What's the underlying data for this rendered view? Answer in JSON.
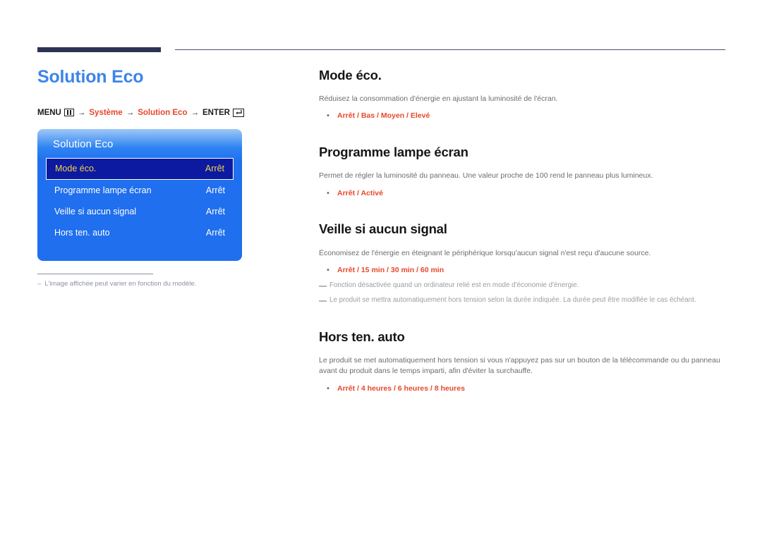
{
  "page": {
    "title": "Solution Eco"
  },
  "breadcrumb": {
    "menu_label": "MENU",
    "menu_icon": "menu-grid-icon",
    "arrow": "→",
    "step1": "Système",
    "step2": "Solution Eco",
    "enter_label": "ENTER",
    "enter_icon": "enter-return-icon"
  },
  "osd": {
    "title": "Solution Eco",
    "rows": [
      {
        "label": "Mode éco.",
        "value": "Arrêt",
        "selected": true
      },
      {
        "label": "Programme lampe écran",
        "value": "Arrêt",
        "selected": false
      },
      {
        "label": "Veille si aucun signal",
        "value": "Arrêt",
        "selected": false
      },
      {
        "label": "Hors ten. auto",
        "value": "Arrêt",
        "selected": false
      }
    ]
  },
  "left_note": {
    "dash": "–",
    "text": "L'image affichée peut varier en fonction du modèle."
  },
  "sections": [
    {
      "heading": "Mode éco.",
      "paragraph": "Réduisez la consommation d'énergie en ajustant la luminosité de l'écran.",
      "bullet_dot": "•",
      "options": [
        "Arrêt",
        "Bas",
        "Moyen",
        "Elevé"
      ],
      "options_text": "Arrêt / Bas / Moyen / Elevé",
      "notes": []
    },
    {
      "heading": "Programme lampe écran",
      "paragraph": "Permet de régler la luminosité du panneau. Une valeur proche de 100 rend le panneau plus lumineux.",
      "bullet_dot": "•",
      "options": [
        "Arrêt",
        "Activé"
      ],
      "options_text": "Arrêt / Activé",
      "notes": []
    },
    {
      "heading": "Veille si aucun signal",
      "paragraph": "Économisez de l'énergie en éteignant le périphérique lorsqu'aucun signal n'est reçu d'aucune source.",
      "bullet_dot": "•",
      "options": [
        "Arrêt",
        "15 min",
        "30 min",
        "60 min"
      ],
      "options_text": "Arrêt / 15 min / 30 min / 60 min",
      "notes": [
        "Fonction désactivée quand un ordinateur relié est en mode d'économie d'énergie.",
        "Le produit se mettra automatiquement hors tension selon la durée indiquée. La durée peut être modifiée le cas échéant."
      ]
    },
    {
      "heading": "Hors ten. auto",
      "paragraph": "Le produit se met automatiquement hors tension si vous n'appuyez pas sur un bouton de la télécommande ou du panneau avant du produit dans le temps imparti, afin d'éviter la surchauffe.",
      "bullet_dot": "•",
      "options": [
        "Arrêt",
        "4 heures",
        "6 heures",
        "8 heures"
      ],
      "options_text": "Arrêt / 4 heures / 6 heures / 8 heures",
      "notes": []
    }
  ],
  "colors": {
    "title_blue": "#3d85e8",
    "accent_red": "#e8472b",
    "rule_navy": "#2e3354",
    "osd_blue": "#1f6fee",
    "osd_selected_bg": "#0b1aa0",
    "osd_selected_text": "#f5d14a",
    "body_gray": "#6a6c70",
    "note_gray": "#9b9da2"
  }
}
